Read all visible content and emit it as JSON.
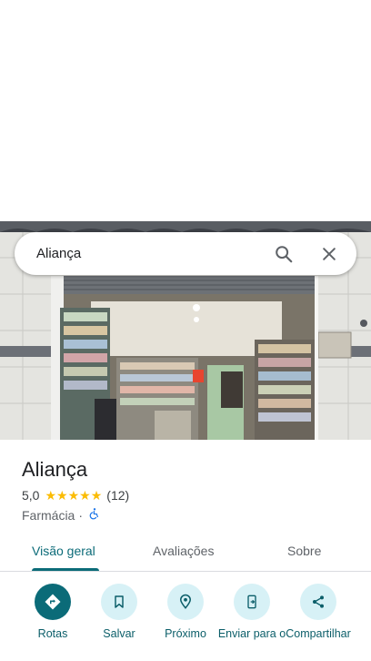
{
  "search": {
    "query": "Aliança"
  },
  "place": {
    "name": "Aliança",
    "rating": "5,0",
    "stars": 5,
    "review_count": "(12)",
    "category": "Farmácia",
    "separator": "·"
  },
  "tabs": [
    {
      "label": "Visão geral",
      "active": true
    },
    {
      "label": "Avaliações",
      "active": false
    },
    {
      "label": "Sobre",
      "active": false
    }
  ],
  "actions": [
    {
      "label": "Rotas",
      "icon": "directions-icon"
    },
    {
      "label": "Salvar",
      "icon": "bookmark-icon"
    },
    {
      "label": "Próximo",
      "icon": "nearby-icon"
    },
    {
      "label": "Enviar para o",
      "icon": "send-to-phone-icon"
    },
    {
      "label": "Compartilhar",
      "icon": "share-icon"
    }
  ],
  "colors": {
    "accent": "#0b6b78",
    "star": "#fbbc04",
    "action_bg": "#d7f1f6"
  }
}
